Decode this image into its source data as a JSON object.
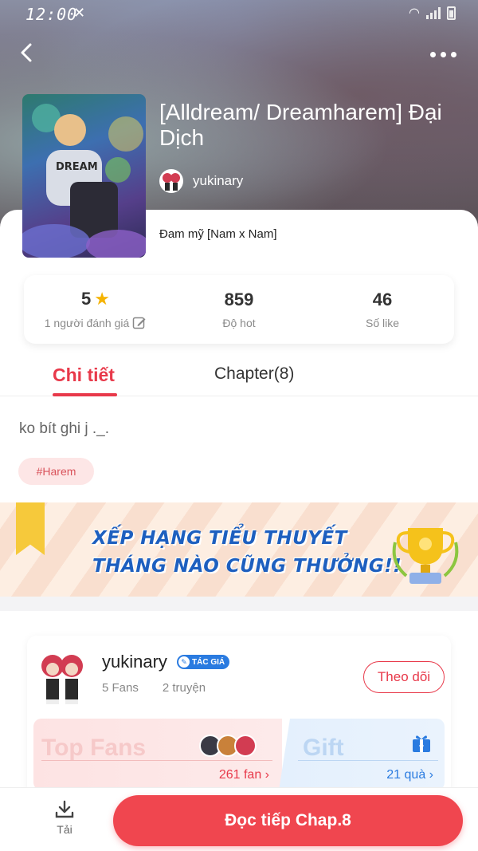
{
  "status_bar": {
    "time": "12:00"
  },
  "novel": {
    "title": "[Alldream/ Dreamharem] Đại Dịch",
    "author": "yukinary",
    "genre": "Đam mỹ [Nam x Nam]",
    "cover_text": "DREAM"
  },
  "stats": {
    "rating_value": "5",
    "rating_label": "1 người đánh giá",
    "hot_value": "859",
    "hot_label": "Độ hot",
    "like_value": "46",
    "like_label": "Số like"
  },
  "tabs": [
    {
      "label": "Chi tiết",
      "active": true
    },
    {
      "label": "Chapter(8)",
      "active": false
    }
  ],
  "detail": {
    "description": "ko bít ghi j ._.",
    "tags": [
      "#Harem"
    ]
  },
  "banner": {
    "line1": "XẾP HẠNG TIỂU THUYẾT",
    "line2": "THÁNG NÀO CŨNG THƯỞNG!!"
  },
  "author_card": {
    "name": "yukinary",
    "badge": "TÁC GIÁ",
    "fans": "5 Fans",
    "stories": "2 truyện",
    "follow_label": "Theo dõi",
    "top_fans_title": "Top Fans",
    "fan_count": "261 fan",
    "gift_title": "Gift",
    "gift_count": "21 quà"
  },
  "bottom_bar": {
    "download_label": "Tải",
    "read_label": "Đọc tiếp Chap.8"
  },
  "colors": {
    "accent": "#e8394a",
    "button": "#f0464f",
    "link_blue": "#2a7be0",
    "star": "#f5b300"
  }
}
